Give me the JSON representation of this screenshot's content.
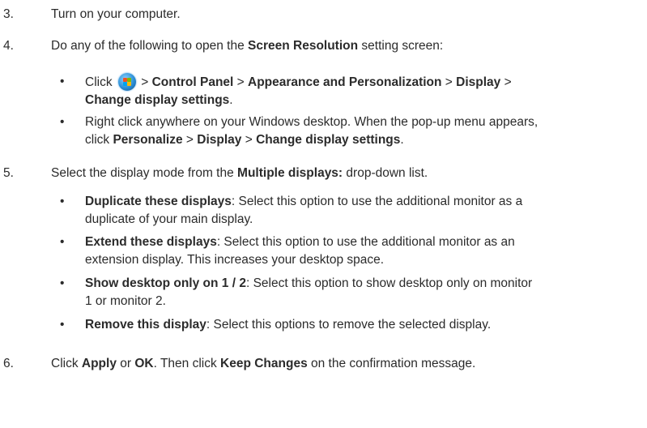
{
  "steps": {
    "s3": {
      "num": "3.",
      "text": "Turn on your computer."
    },
    "s4": {
      "num": "4.",
      "pre": "Do any of the following to open the ",
      "bold": "Screen Resolution",
      "post": " setting screen:"
    },
    "s5": {
      "num": "5.",
      "pre": "Select the display mode from the ",
      "bold": "Multiple displays:",
      "post": " drop-down list."
    },
    "s6": {
      "num": "6.",
      "t1": "Click ",
      "b1": "Apply",
      "t2": " or ",
      "b2": "OK",
      "t3": ". Then click ",
      "b3": "Keep Changes",
      "t4": " on the confirmation message."
    }
  },
  "bullets4": {
    "b1": {
      "click": "Click",
      "icon": "windows-start-orb-icon",
      "sep1": " > ",
      "cp": "Control Panel",
      "sep2": " > ",
      "ap": "Appearance and Personalization",
      "sep3": " > ",
      "disp": "Display",
      "sep4": " >",
      "cds": "Change display settings",
      "end": "."
    },
    "b2": {
      "line1": "Right click anywhere on your Windows desktop. When the pop-up menu appears,",
      "click": "click ",
      "pers": "Personalize",
      "sep1": " > ",
      "disp": "Display",
      "sep2": " > ",
      "cds": "Change display settings",
      "end": "."
    }
  },
  "bullets5": {
    "dup": {
      "bold": "Duplicate these displays",
      "line1": ": Select this option to use the additional monitor as a",
      "line2": "duplicate of your main display."
    },
    "ext": {
      "bold": "Extend these displays",
      "line1": ": Select this option to use the additional monitor as an",
      "line2": "extension display. This increases your desktop space."
    },
    "show": {
      "bold": "Show desktop only on 1 / 2",
      "line1": ": Select this option to show desktop only on monitor",
      "line2": "1 or monitor 2."
    },
    "rem": {
      "bold": "Remove this display",
      "line1": ": Select this options to remove the selected display."
    }
  },
  "bullet_char": "•"
}
